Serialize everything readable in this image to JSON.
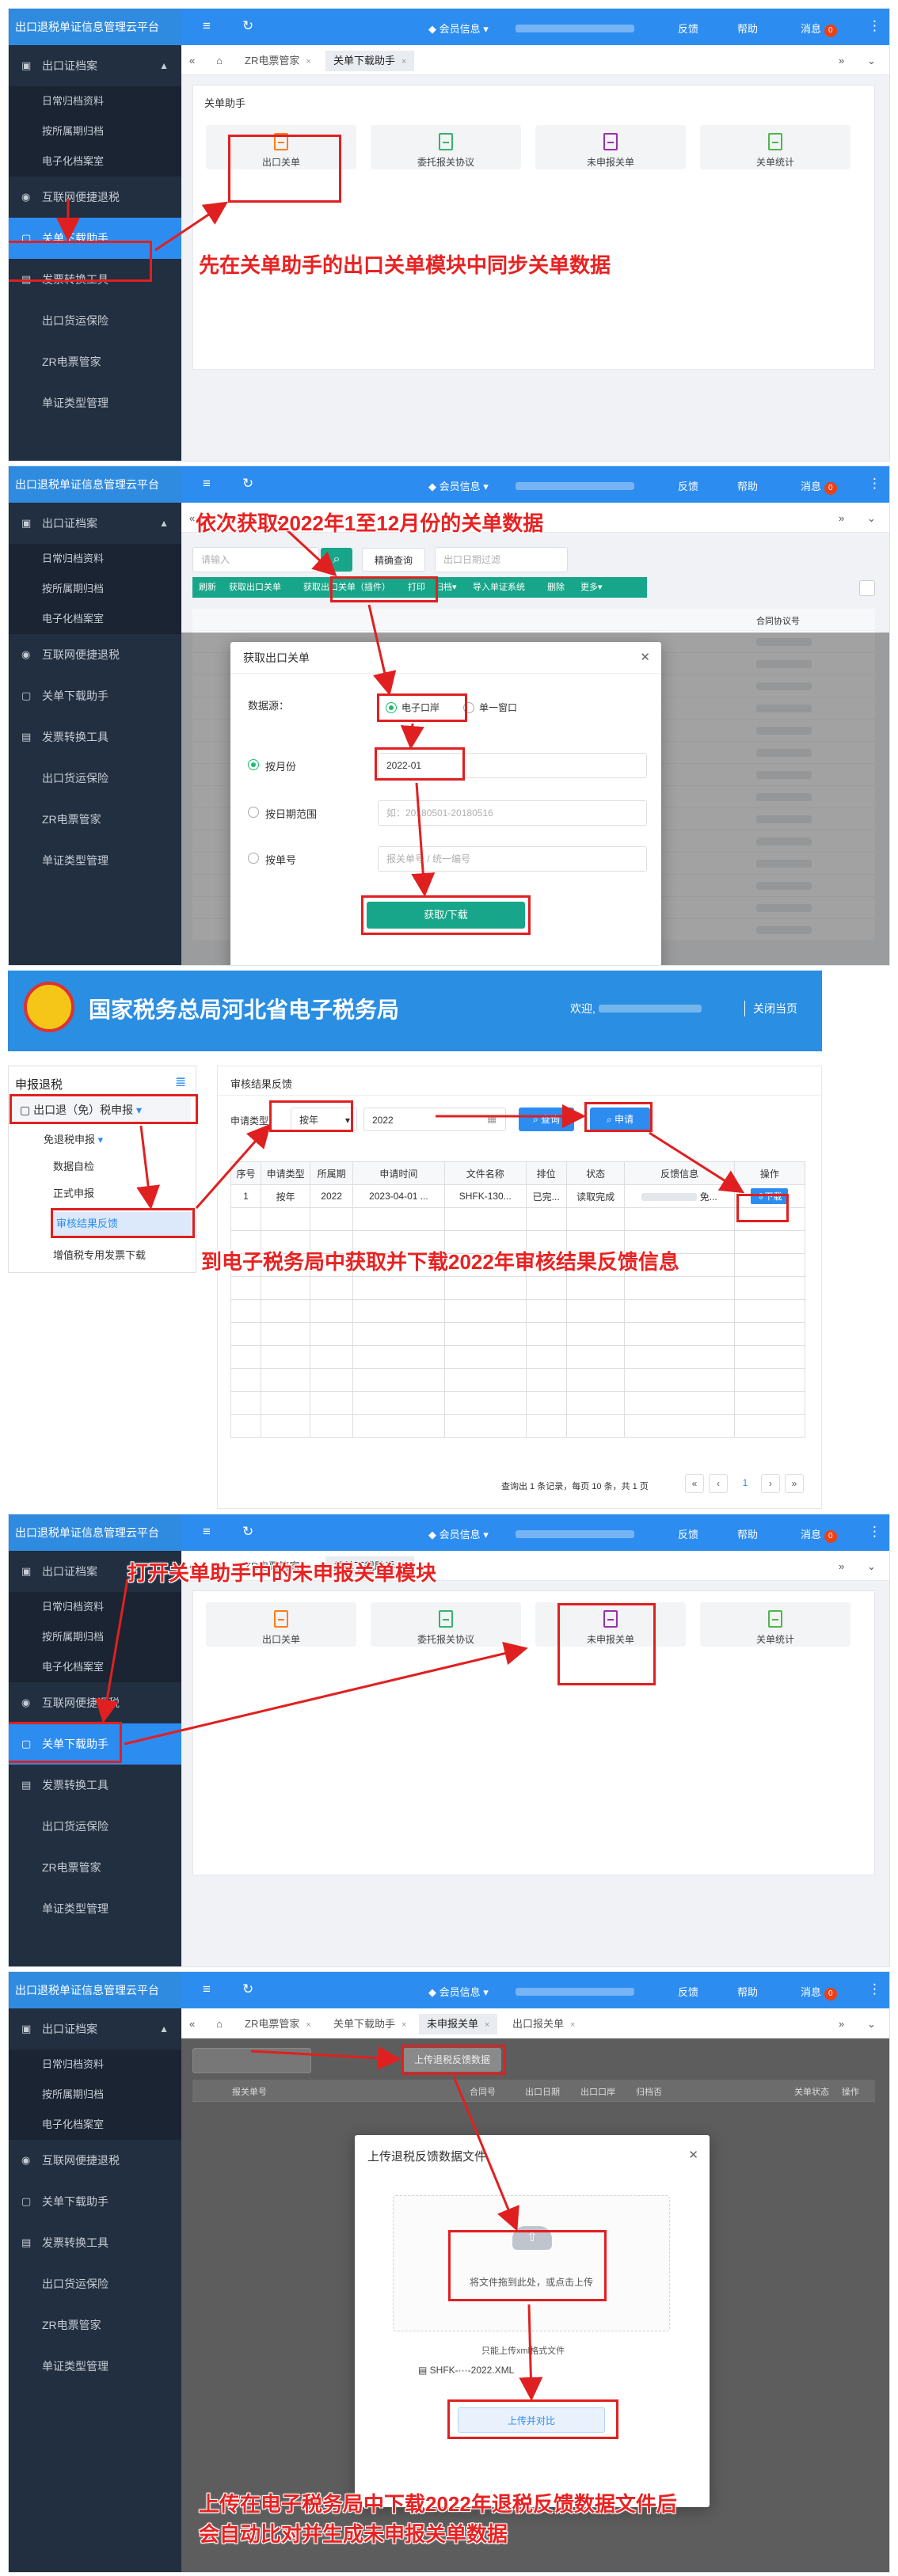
{
  "common": {
    "app_title": "出口退税单证信息管理云平台",
    "menu_icon": "≡",
    "refresh_icon": "↻",
    "member_info": "会员信息",
    "feedback": "反馈",
    "help": "帮助",
    "messages": "消息",
    "message_count": "0",
    "more_icon": "⋮",
    "tab_prev": "«",
    "tab_next": "»",
    "tab_home_icon": "⌂",
    "sidebar_items": [
      "出口证档案",
      "互联网便捷退税",
      "关单下载助手",
      "发票转换工具",
      "出口货运保险",
      "ZR电票管家",
      "单证类型管理"
    ],
    "sidebar_subitems": [
      "日常归档资料",
      "按所属期归档",
      "电子化档案室"
    ]
  },
  "panel1": {
    "tabs": [
      "ZR电票管家",
      "关单下载助手"
    ],
    "card_title": "关单助手",
    "modules": [
      "出口关单",
      "委托报关协议",
      "未申报关单",
      "关单统计"
    ],
    "annotation": "先在关单助手的出口关单模块中同步关单数据"
  },
  "panel2": {
    "annotation": "依次获取2022年1至12月份的关单数据",
    "search_placeholder": "请输入",
    "search_icon": "⌕",
    "advanced_search": "精确查询",
    "period_placeholder": "出口日期过滤",
    "toolbar": [
      "刷新",
      "获取出口关单",
      "获取出口关单（插件）",
      "打印",
      "归档",
      "导入单证系统",
      "删除",
      "更多"
    ],
    "bg_header": "合同协议号",
    "modal_title": "获取出口关单",
    "data_source_label": "数据源：",
    "source_options": [
      "电子口岸",
      "单一窗口"
    ],
    "by_month_label": "按月份",
    "month_value": "2022-01",
    "by_date_label": "按日期范围",
    "date_placeholder": "如：20180501-20180516",
    "by_no_label": "按单号",
    "no_placeholder": "报关单号 / 统一编号",
    "submit": "获取/下载"
  },
  "panel3": {
    "site_title": "国家税务总局河北省电子税务局",
    "welcome": "欢迎,",
    "close_page": "关闭当页",
    "menu_title": "申报退税",
    "menu_dropdown": "出口退（免）税申报",
    "menu_items": [
      "免退税申报",
      "数据自检",
      "正式申报",
      "审核结果反馈",
      "增值税专用发票下载"
    ],
    "card_title": "审核结果反馈",
    "filter_label": "申请类型:",
    "filter_type": "按年",
    "filter_year": "2022",
    "query_btn": "查询",
    "apply_btn": "申请",
    "table_headers": [
      "序号",
      "申请类型",
      "所属期",
      "申请时间",
      "文件名称",
      "排位",
      "状态",
      "反馈信息",
      "操作"
    ],
    "table_row": [
      "1",
      "按年",
      "2022",
      "2023-04-01 ...",
      "SHFK-130...",
      "已完...",
      "读取完成",
      "免...",
      "下载"
    ],
    "pagination_text": "查询出 1 条记录，每页 10 条，共 1 页",
    "page_first": "«",
    "page_prev": "‹",
    "page_current": "1",
    "page_next": "›",
    "page_last": "»",
    "annotation": "到电子税务局中获取并下载2022年审核结果反馈信息"
  },
  "panel4": {
    "tabs": [
      "ZR电票管家",
      "关单下载助手"
    ],
    "modules": [
      "出口关单",
      "委托报关协议",
      "未申报关单",
      "关单统计"
    ],
    "annotation": "打开关单助手中的未申报关单模块"
  },
  "panel5": {
    "tabs": [
      "ZR电票管家",
      "关单下载助手",
      "未申报关单",
      "出口报关单"
    ],
    "upload_btn": "上传退税反馈数据",
    "bg_headers": [
      "报关单号",
      "合同号",
      "出口日期",
      "出口口岸",
      "归档否",
      "关单状态",
      "操作"
    ],
    "modal_title": "上传退税反馈数据文件",
    "drop_text": "将文件拖到此处，或点击上传",
    "file_hint": "只能上传xml格式文件",
    "file_name": "SHFK-···-2022.XML",
    "start_btn": "上传并对比",
    "annotation_line1": "上传在电子税务局中下载2022年退税反馈数据文件后",
    "annotation_line2": "会自动比对并生成未申报关单数据"
  },
  "colors": {
    "accent": "#2d8cf0",
    "sidebar": "#222f40",
    "annotation": "#e82222",
    "success": "#19be6b"
  }
}
